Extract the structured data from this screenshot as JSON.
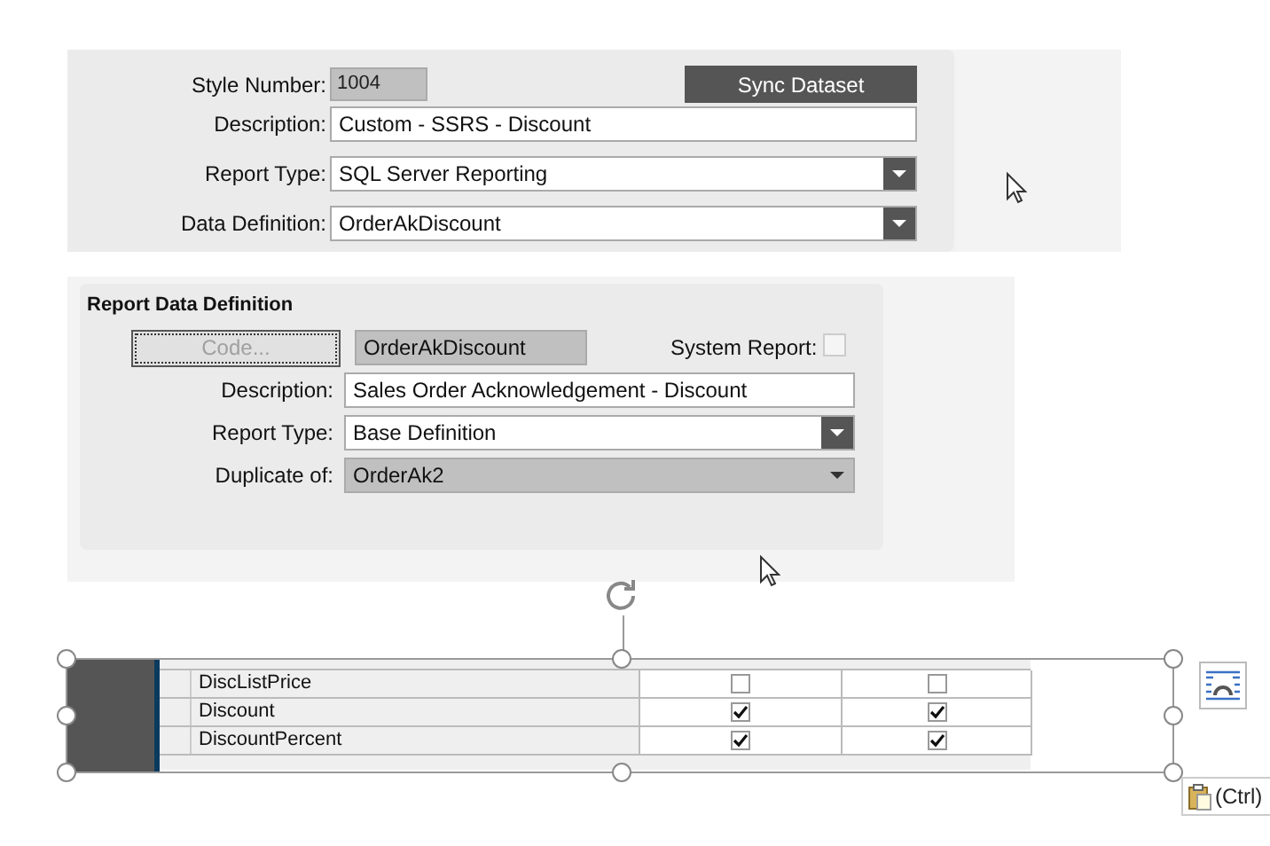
{
  "style_panel": {
    "style_number": {
      "label": "Style Number:",
      "value": "1004"
    },
    "sync_button": "Sync Dataset",
    "fields": [
      {
        "label": "Description:",
        "value": "Custom - SSRS - Discount",
        "kind": "text"
      },
      {
        "label": "Report Type:",
        "value": "SQL Server Reporting",
        "kind": "dropdown"
      },
      {
        "label": "Data Definition:",
        "value": "OrderAkDiscount",
        "kind": "dropdown"
      }
    ]
  },
  "report_data_definition": {
    "title": "Report Data Definition",
    "code_button": {
      "label": "Code...",
      "disabled": true
    },
    "code_value": "OrderAkDiscount",
    "system_report": {
      "label": "System Report:",
      "checked": false
    },
    "fields": [
      {
        "label": "Description:",
        "value": "Sales Order Acknowledgement - Discount",
        "kind": "text"
      },
      {
        "label": "Report Type:",
        "value": "Base Definition",
        "kind": "dropdown"
      },
      {
        "label": "Duplicate of:",
        "value": "OrderAk2",
        "kind": "locked_dropdown"
      }
    ]
  },
  "pasted_table": {
    "rows": [
      {
        "name": "DiscListPrice",
        "checks": [
          false,
          false
        ]
      },
      {
        "name": "Discount",
        "checks": [
          true,
          true
        ]
      },
      {
        "name": "DiscountPercent",
        "checks": [
          true,
          true
        ]
      }
    ]
  },
  "paste_options": {
    "label": "(Ctrl)"
  }
}
